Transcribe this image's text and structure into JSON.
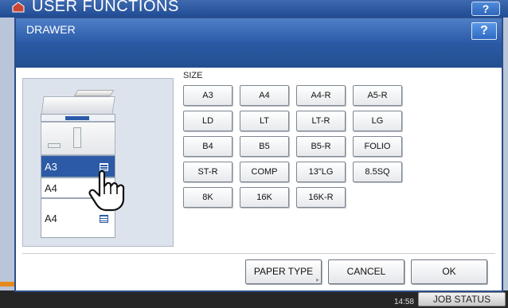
{
  "app": {
    "title": "USER FUNCTIONS",
    "help_label": "?"
  },
  "dialog": {
    "title": "DRAWER",
    "help_label": "?"
  },
  "drawers": [
    {
      "label": "A3",
      "selected": true
    },
    {
      "label": "A4",
      "selected": false
    },
    {
      "label": "A4",
      "selected": false
    }
  ],
  "size": {
    "label": "SIZE",
    "buttons": [
      [
        "A3",
        "A4",
        "A4-R",
        "A5-R"
      ],
      [
        "LD",
        "LT",
        "LT-R",
        "LG"
      ],
      [
        "B4",
        "B5",
        "B5-R",
        "FOLIO"
      ],
      [
        "ST-R",
        "COMP",
        "13\"LG",
        "8.5SQ"
      ],
      [
        "8K",
        "16K",
        "16K-R"
      ]
    ]
  },
  "footer": {
    "paper_type": "PAPER TYPE",
    "cancel": "CANCEL",
    "ok": "OK"
  },
  "status_bar": {
    "time": "14:58",
    "job_status": "JOB STATUS"
  },
  "colors": {
    "header_blue": "#2c5ca8",
    "selected_drawer": "#2c5aa6",
    "accent_orange": "#e58a1f"
  }
}
